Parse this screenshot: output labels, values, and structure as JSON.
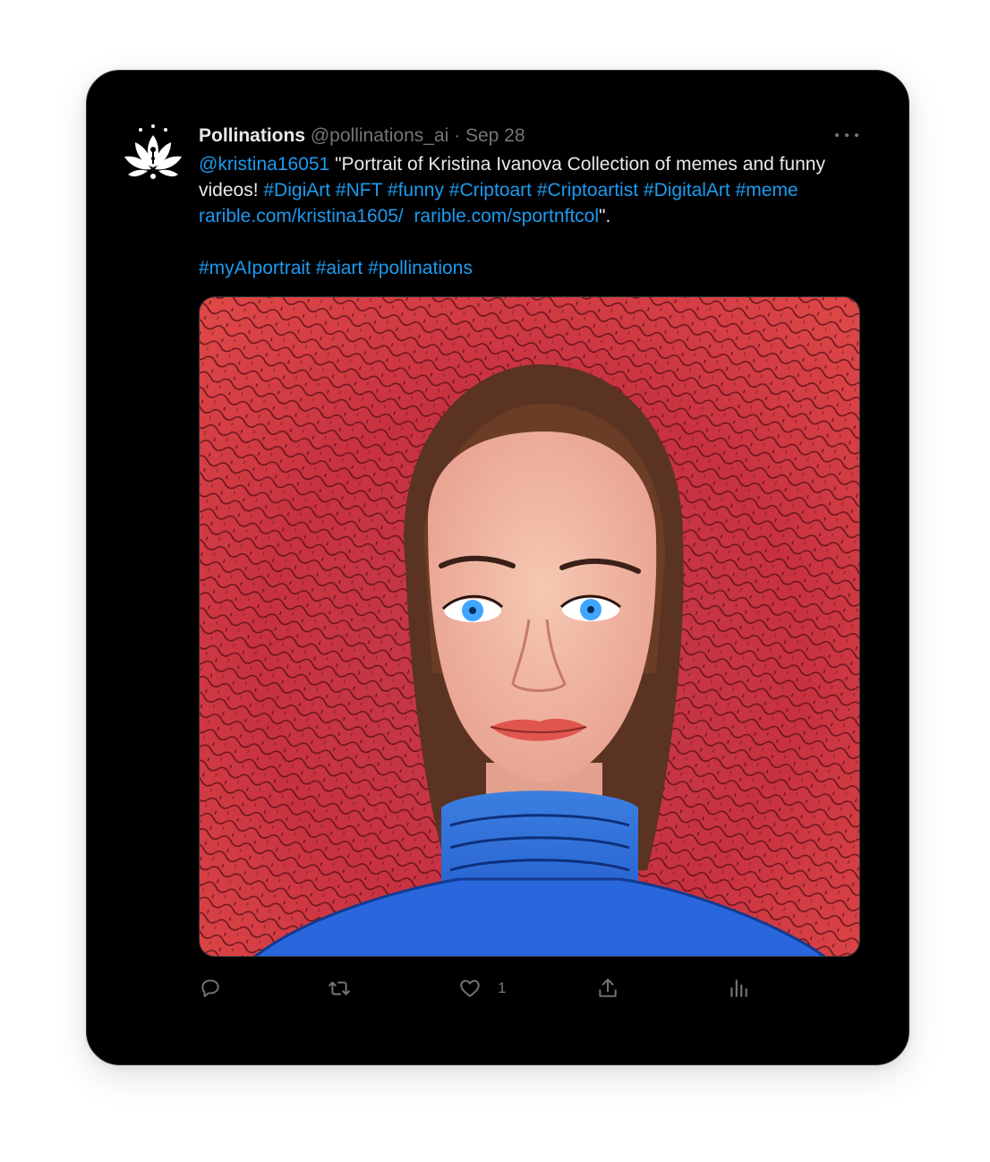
{
  "tweet": {
    "display_name": "Pollinations",
    "handle": "@pollinations_ai",
    "separator": "·",
    "date": "Sep 28",
    "mention": "@kristina16051",
    "text_quote_open": " \"Portrait of Kristina Ivanova Collection of memes and funny videos! ",
    "hashtags_line1": [
      "#DigiArt",
      "#NFT",
      "#funny",
      "#Criptoart",
      "#Criptoartist",
      "#DigitalArt",
      "#meme"
    ],
    "link1": "rarible.com/kristina1605/",
    "link2": "rarible.com/sportnftcol",
    "text_quote_close": "\".",
    "hashtags_line2": [
      "#myAIportrait",
      "#aiart",
      "#pollinations"
    ],
    "media_alt": "AI generated portrait",
    "like_count": "1"
  },
  "icons": {
    "avatar": "lotus-logo-icon",
    "more": "more-dots-icon",
    "reply": "reply-icon",
    "retweet": "retweet-icon",
    "like": "heart-icon",
    "share": "share-icon",
    "analytics": "analytics-icon"
  },
  "colors": {
    "background": "#000000",
    "text": "#e7e9ea",
    "secondary": "#71767b",
    "link": "#1d9bf0"
  }
}
